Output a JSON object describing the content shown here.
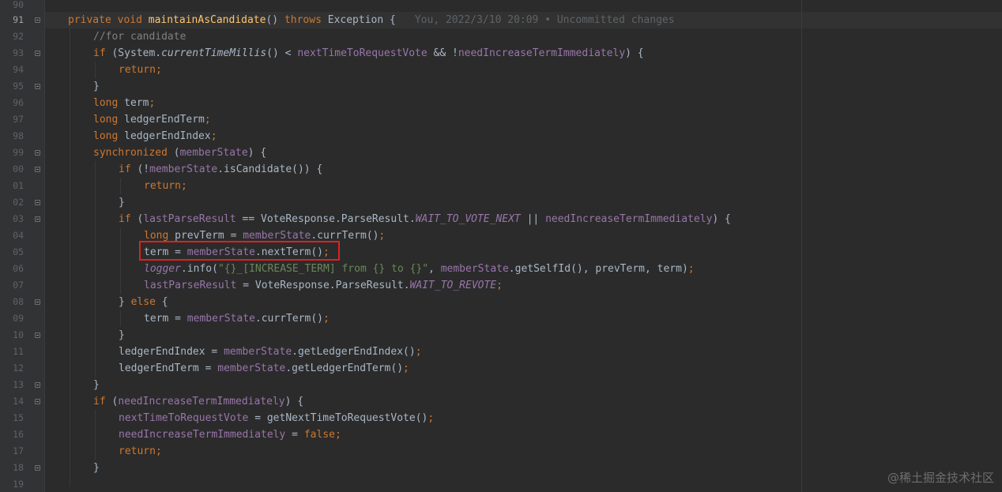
{
  "editor": {
    "gutter": [
      "90",
      "91",
      "92",
      "93",
      "94",
      "95",
      "96",
      "97",
      "98",
      "99",
      "00",
      "01",
      "02",
      "03",
      "04",
      "05",
      "06",
      "07",
      "08",
      "09",
      "10",
      "11",
      "12",
      "13",
      "14",
      "15",
      "16",
      "17",
      "18",
      "19"
    ],
    "blame": "You, 2022/3/10 20:09 • Uncommitted changes",
    "lines": {
      "l91": {
        "t1": "private void ",
        "fn": "maintainAsCandidate",
        "t2": "() ",
        "kw2": "throws",
        "t3": " Exception {"
      },
      "l92": {
        "comment": "//for candidate"
      },
      "l93": {
        "kw": "if",
        "t1": " (System.",
        "call": "currentTimeMillis",
        "t2": "() < ",
        "f1": "nextTimeToRequestVote",
        "t3": " && !",
        "f2": "needIncreaseTermImmediately",
        "t4": ") {"
      },
      "l94": {
        "kw": "return",
        "semi": ";"
      },
      "l95": {
        "t": "}"
      },
      "l96": {
        "kw": "long",
        "t": " term",
        "semi": ";"
      },
      "l97": {
        "kw": "long",
        "t": " ledgerEndTerm",
        "semi": ";"
      },
      "l98": {
        "kw": "long",
        "t": " ledgerEndIndex",
        "semi": ";"
      },
      "l99": {
        "kw": "synchronized",
        "t1": " (",
        "f": "memberState",
        "t2": ") {"
      },
      "l00": {
        "kw": "if",
        "t1": " (!",
        "f": "memberState",
        "t2": ".isCandidate()) {"
      },
      "l01": {
        "kw": "return",
        "semi": ";"
      },
      "l02": {
        "t": "}"
      },
      "l03": {
        "kw": "if",
        "t1": " (",
        "f1": "lastParseResult",
        "t2": " == VoteResponse.ParseResult.",
        "sf": "WAIT_TO_VOTE_NEXT",
        "t3": " || ",
        "f2": "needIncreaseTermImmediately",
        "t4": ") {"
      },
      "l04": {
        "kw": "long",
        "t1": " prevTerm = ",
        "f": "memberState",
        "t2": ".currTerm()",
        "semi": ";"
      },
      "l05": {
        "t1": "term = ",
        "f": "memberState",
        "t2": ".nextTerm()",
        "semi": ";"
      },
      "l06": {
        "sf": "logger",
        "t1": ".info(",
        "str": "\"{}_[INCREASE_TERM] from {} to {}\"",
        "t2": ", ",
        "f": "memberState",
        "t3": ".getSelfId(), prevTerm, term)",
        "semi": ";"
      },
      "l07": {
        "f": "lastParseResult",
        "t1": " = VoteResponse.ParseResult.",
        "sf": "WAIT_TO_REVOTE",
        "semi": ";"
      },
      "l08": {
        "t1": "} ",
        "kw": "else",
        "t2": " {"
      },
      "l09": {
        "t1": "term = ",
        "f": "memberState",
        "t2": ".currTerm()",
        "semi": ";"
      },
      "l10": {
        "t": "}"
      },
      "l11": {
        "t1": "ledgerEndIndex = ",
        "f": "memberState",
        "t2": ".getLedgerEndIndex()",
        "semi": ";"
      },
      "l12": {
        "t1": "ledgerEndTerm = ",
        "f": "memberState",
        "t2": ".getLedgerEndTerm()",
        "semi": ";"
      },
      "l13": {
        "t": "}"
      },
      "l14": {
        "kw": "if",
        "t1": " (",
        "f": "needIncreaseTermImmediately",
        "t2": ") {"
      },
      "l15": {
        "f": "nextTimeToRequestVote",
        "t1": " = getNextTimeToRequestVote()",
        "semi": ";"
      },
      "l16": {
        "f": "needIncreaseTermImmediately",
        "t1": " = ",
        "kw": "false",
        "semi": ";"
      },
      "l17": {
        "kw": "return",
        "semi": ";"
      },
      "l18": {
        "t": "}"
      }
    }
  },
  "watermark": "@稀土掘金技术社区",
  "colors": {
    "background": "#2b2b2b",
    "keyword": "#cc7832",
    "method": "#ffc66d",
    "field": "#9876aa",
    "string": "#6a8759",
    "comment": "#808080",
    "highlight_box": "#e02020"
  }
}
